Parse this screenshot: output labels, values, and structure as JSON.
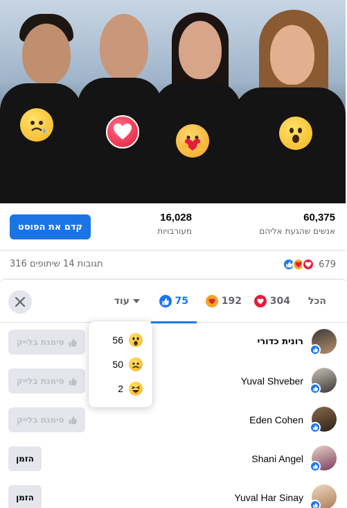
{
  "stats": {
    "reach_value": "60,375",
    "reach_label": "אנשים שהגעת אליהם",
    "engagement_value": "16,028",
    "engagement_label": "מעורבויות",
    "boost_label": "קדם את הפוסט"
  },
  "counts": {
    "reactions_total": "679",
    "comments_shares": "316 תגובות 14 שיתופים"
  },
  "tabs": [
    {
      "label": "הכל"
    },
    {
      "label": "304",
      "icon": "love-icon"
    },
    {
      "label": "192",
      "icon": "care-icon"
    },
    {
      "label": "75",
      "icon": "like-icon"
    },
    {
      "label": "עוד",
      "icon": "chevron-down-icon"
    }
  ],
  "dropdown": [
    {
      "count": "56",
      "icon": "wow-icon"
    },
    {
      "count": "50",
      "icon": "sad-icon"
    },
    {
      "count": "2",
      "icon": "haha-icon"
    }
  ],
  "people": [
    {
      "name": "רונית כדורי",
      "action": "סימנת בלייק"
    },
    {
      "name": "Yuval Shveber",
      "action": "סימנת בלייק"
    },
    {
      "name": "Eden Cohen",
      "action": "סימנת בלייק"
    },
    {
      "name": "Shani Angel",
      "action": "הזמן"
    },
    {
      "name": "Yuval Har Sinay",
      "action": "הזמן"
    }
  ],
  "colors": {
    "accent": "#1877f2",
    "boost": "#1b74e4",
    "love": "#e41c3d",
    "care": "#f3a625"
  }
}
